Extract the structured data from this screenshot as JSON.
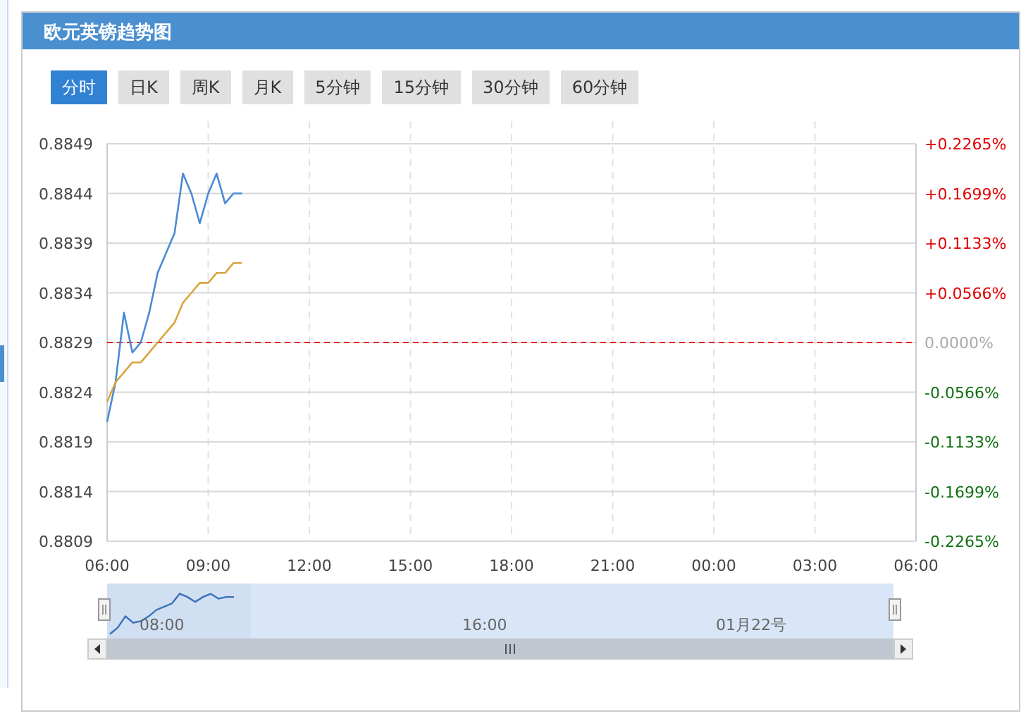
{
  "panel": {
    "title": "欧元英镑趋势图"
  },
  "tabs": [
    {
      "label": "分时",
      "selected": true
    },
    {
      "label": "日K",
      "selected": false
    },
    {
      "label": "周K",
      "selected": false
    },
    {
      "label": "月K",
      "selected": false
    },
    {
      "label": "5分钟",
      "selected": false
    },
    {
      "label": "15分钟",
      "selected": false
    },
    {
      "label": "30分钟",
      "selected": false
    },
    {
      "label": "60分钟",
      "selected": false
    }
  ],
  "chart": {
    "chart_data": {
      "type": "line",
      "x": [
        6,
        6.25,
        6.5,
        6.75,
        7,
        7.25,
        7.5,
        7.75,
        8,
        8.25,
        8.5,
        8.75,
        9,
        9.25,
        9.5,
        9.75,
        10
      ],
      "series": [
        {
          "color": "#4a8ad6",
          "values": [
            0.8821,
            0.8825,
            0.8832,
            0.8828,
            0.8829,
            0.8832,
            0.8836,
            0.8838,
            0.884,
            0.8846,
            0.8844,
            0.8841,
            0.8844,
            0.8846,
            0.8843,
            0.8844,
            0.8844
          ]
        },
        {
          "color": "#d9a540",
          "values": [
            0.8823,
            0.8825,
            0.8826,
            0.8827,
            0.8827,
            0.8828,
            0.8829,
            0.883,
            0.8831,
            0.8833,
            0.8834,
            0.8835,
            0.8835,
            0.8836,
            0.8836,
            0.8837,
            0.8837
          ]
        }
      ],
      "xlim": [
        6,
        30
      ],
      "ylim": [
        0.8809,
        0.8849
      ],
      "grid": true,
      "xticks": [
        {
          "value": 6,
          "label": "06:00"
        },
        {
          "value": 9,
          "label": "09:00"
        },
        {
          "value": 12,
          "label": "12:00"
        },
        {
          "value": 15,
          "label": "15:00"
        },
        {
          "value": 18,
          "label": "18:00"
        },
        {
          "value": 21,
          "label": "21:00"
        },
        {
          "value": 24,
          "label": "00:00"
        }
      ],
      "yticks": [
        {
          "value": 0.8849,
          "label": "0.8849"
        },
        {
          "value": 0.8844,
          "label": "0.8844"
        },
        {
          "value": 0.8839,
          "label": "0.8839"
        },
        {
          "value": 0.8834,
          "label": "0.8834"
        },
        {
          "value": 0.8829,
          "label": "0.8829"
        },
        {
          "value": 0.8824,
          "label": "0.8824"
        },
        {
          "value": 0.8819,
          "label": "0.8819"
        },
        {
          "value": 0.8814,
          "label": "0.8814"
        },
        {
          "value": 0.8809,
          "label": "0.8809"
        }
      ],
      "ref_lines": [
        {
          "axis": "y",
          "value": 0.8829,
          "color": "#e02020"
        }
      ]
    },
    "next_day_time_labels": [
      "03:00",
      "06:00"
    ],
    "percent_labels": [
      {
        "text": "+0.2265%",
        "kind": "up"
      },
      {
        "text": "+0.1699%",
        "kind": "up"
      },
      {
        "text": "+0.1133%",
        "kind": "up"
      },
      {
        "text": "+0.0566%",
        "kind": "up"
      },
      {
        "text": "0.0000%",
        "kind": "flat"
      },
      {
        "text": "-0.0566%",
        "kind": "down"
      },
      {
        "text": "-0.1133%",
        "kind": "down"
      },
      {
        "text": "-0.1699%",
        "kind": "down"
      },
      {
        "text": "-0.2265%",
        "kind": "down"
      }
    ]
  },
  "navigator": {
    "labels": [
      "08:00",
      "16:00",
      "01月22号"
    ]
  }
}
